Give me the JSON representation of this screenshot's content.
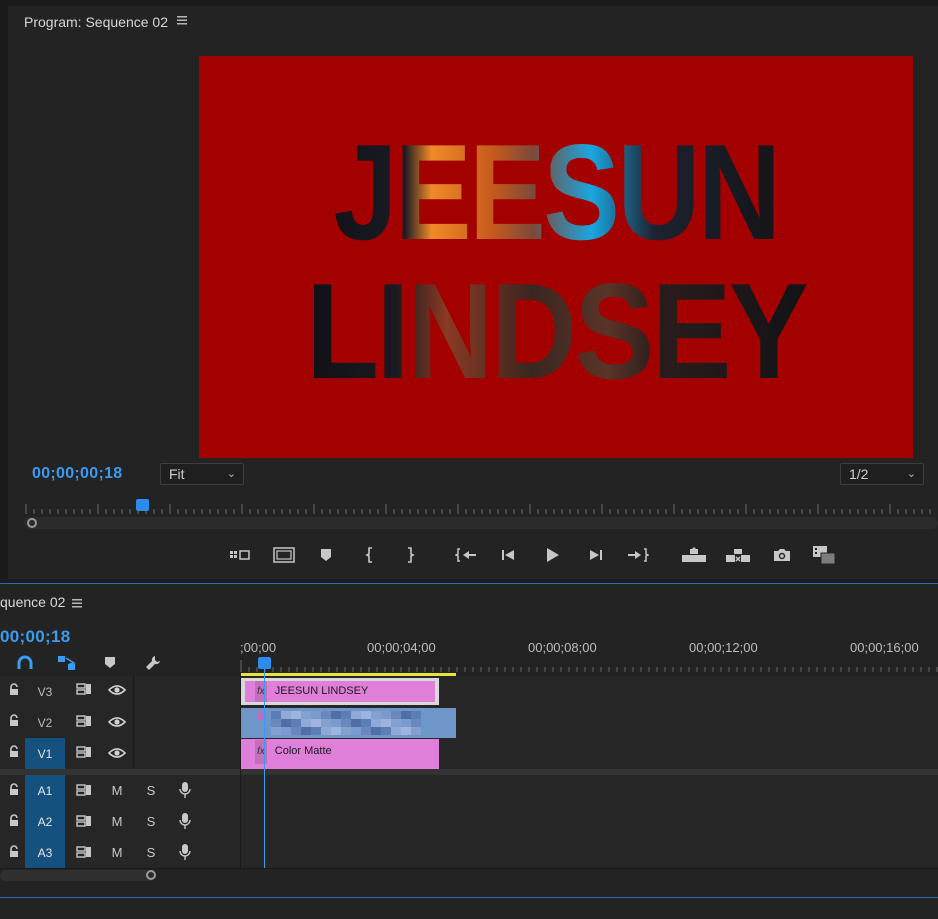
{
  "program_monitor": {
    "title": "Program: Sequence 02",
    "menu_icon": "hamburger-menu-icon",
    "video_text_line1": "JEESUN",
    "video_text_line2": "LINDSEY",
    "background_color": "#a30000",
    "timecode": "00;00;00;18",
    "fit_select": "Fit",
    "resolution_select": "1/2",
    "transport_buttons": [
      {
        "name": "settings-icon"
      },
      {
        "name": "safe-margins-icon"
      },
      {
        "name": "add-marker-icon"
      },
      {
        "name": "mark-in-icon"
      },
      {
        "name": "mark-out-icon"
      },
      {
        "name": "go-to-in-icon"
      },
      {
        "name": "step-back-icon"
      },
      {
        "name": "play-icon"
      },
      {
        "name": "step-forward-icon"
      },
      {
        "name": "go-to-out-icon"
      },
      {
        "name": "lift-icon"
      },
      {
        "name": "extract-icon"
      },
      {
        "name": "export-frame-icon"
      },
      {
        "name": "comparison-view-icon"
      }
    ]
  },
  "timeline": {
    "title": "quence 02",
    "menu_icon": "hamburger-menu-icon",
    "timecode": "00;00;18",
    "ruler_labels": [
      ";00;00",
      "00;00;04;00",
      "00;00;08;00",
      "00;00;12;00",
      "00;00;16;00"
    ],
    "tools": [
      "snap-magnet-icon",
      "linked-selection-icon",
      "add-marker-icon",
      "wrench-icon"
    ],
    "video_tracks": [
      {
        "label": "V3",
        "active": false
      },
      {
        "label": "V2",
        "active": false
      },
      {
        "label": "V1",
        "active": true
      }
    ],
    "audio_tracks": [
      {
        "label": "A1",
        "mute": "M",
        "solo": "S"
      },
      {
        "label": "A2",
        "mute": "M",
        "solo": "S"
      },
      {
        "label": "A3",
        "mute": "M",
        "solo": "S"
      }
    ],
    "clips": {
      "v3": {
        "name": "JEESUN LINDSEY",
        "fx": "fx",
        "color": "#e07fd9"
      },
      "v2": {
        "name": "",
        "color": "#6f96c9"
      },
      "v1": {
        "name": "Color Matte",
        "fx": "fx",
        "color": "#e07fd9"
      }
    }
  }
}
